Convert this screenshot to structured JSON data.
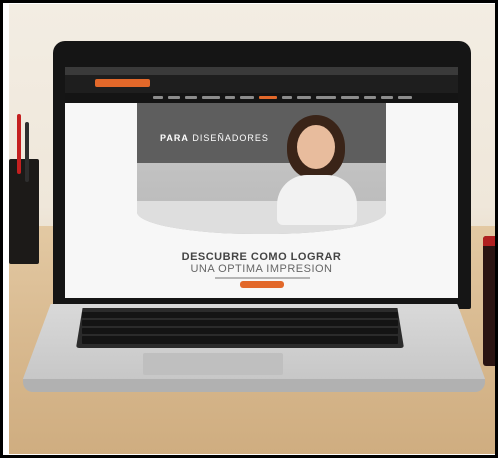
{
  "screen": {
    "hero_title_bold": "PARA",
    "hero_title_light": " DISEÑADORES",
    "headline_line1": "DESCUBRE COMO LOGRAR",
    "headline_line2": "UNA OPTIMA IMPRESION"
  },
  "colors": {
    "brand_orange": "#e2682a",
    "site_header": "#1e1e1e"
  }
}
